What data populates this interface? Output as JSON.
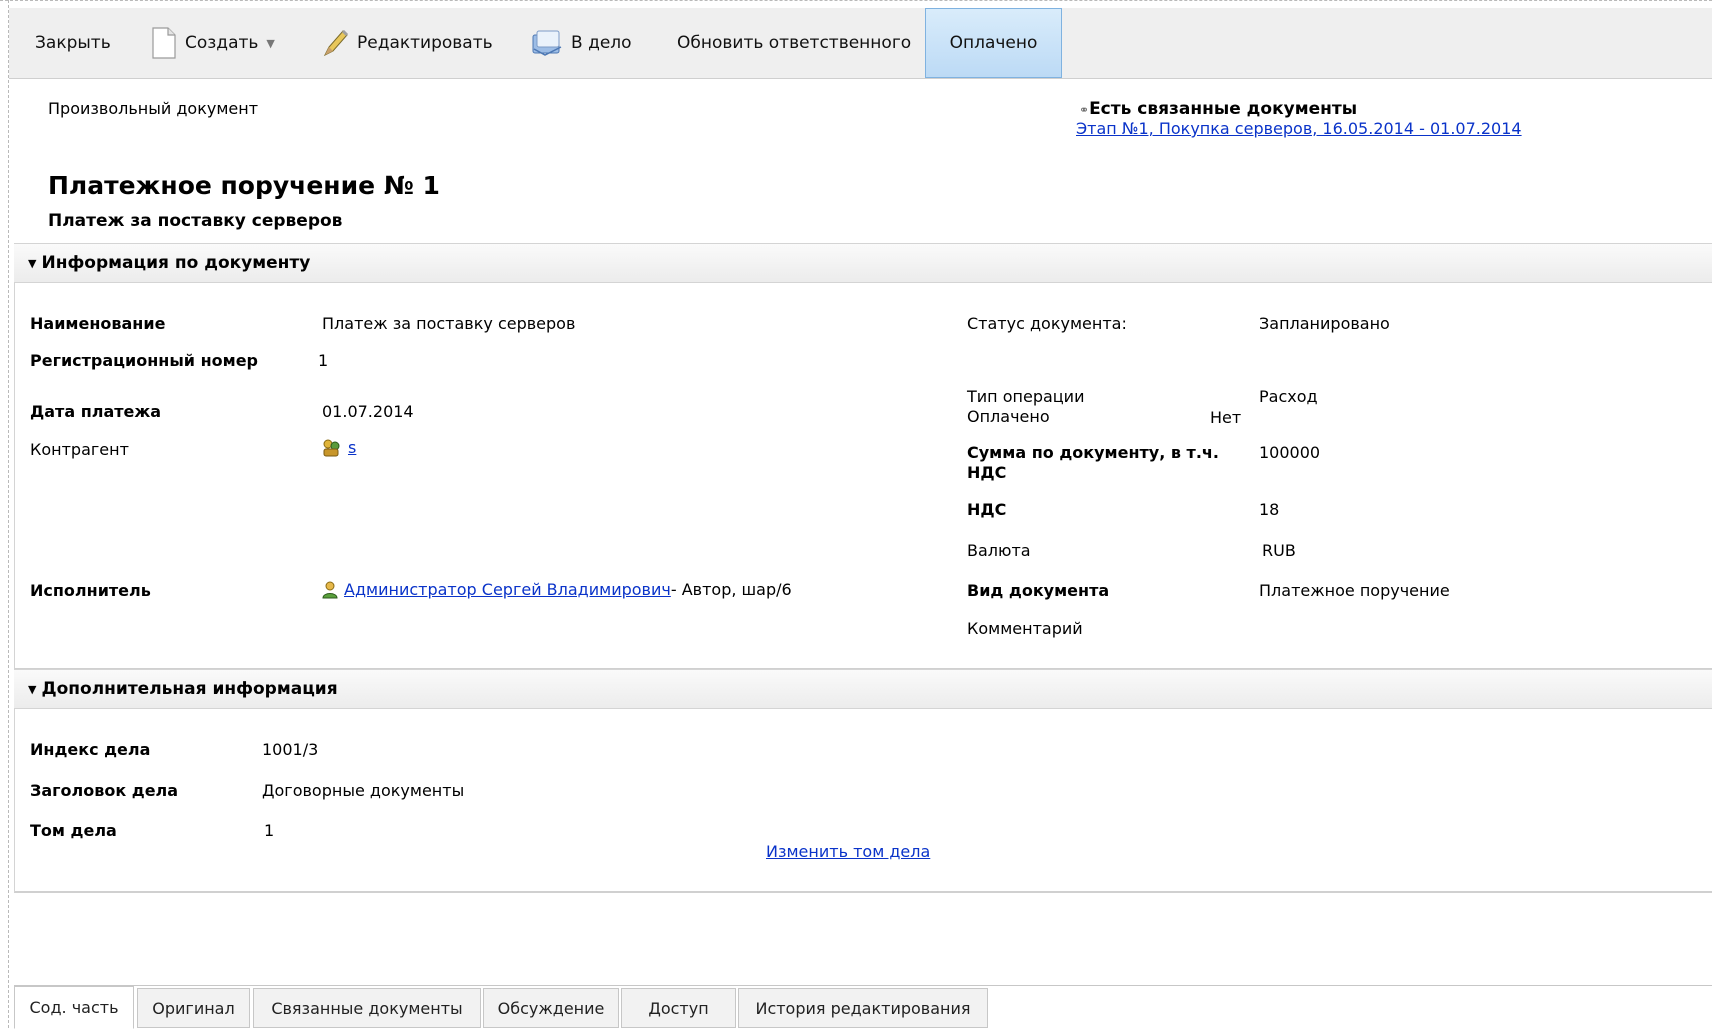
{
  "toolbar": {
    "close": "Закрыть",
    "create": "Создать",
    "edit": "Редактировать",
    "to_case": "В дело",
    "update_responsible": "Обновить ответственного",
    "paid": "Оплачено"
  },
  "doc": {
    "type_label": "Произвольный документ",
    "related_heading": "Есть связанные документы",
    "related_link": "Этап №1, Покупка серверов, 16.05.2014 - 01.07.2014",
    "title": "Платежное поручение № 1",
    "subtitle": "Платеж за поставку серверов"
  },
  "info_section": {
    "header": "Информация по документу",
    "name_label": "Наименование",
    "name_value": "Платеж за поставку серверов",
    "regnum_label": "Регистрационный номер",
    "regnum_value": "1",
    "paydate_label": "Дата платежа",
    "paydate_value": "01.07.2014",
    "counterparty_label": "Контрагент",
    "counterparty_value": "s",
    "executor_label": "Исполнитель",
    "executor_value": "Администратор Сергей Владимирович",
    "executor_suffix": " - Автор, шар/6",
    "status_label": "Статус документа:",
    "status_value": "Запланировано",
    "optype_label": "Тип операции",
    "optype_value": "Расход",
    "paid_label": "Оплачено",
    "paid_value": "Нет",
    "sum_label_1": "Сумма по документу, в т.ч.",
    "sum_label_2": "НДС",
    "sum_value": "100000",
    "vat_label": "НДС",
    "vat_value": "18",
    "currency_label": "Валюта",
    "currency_value": "RUB",
    "doctype_label": "Вид документа",
    "doctype_value": "Платежное поручение",
    "comment_label": "Комментарий"
  },
  "extra_section": {
    "header": "Дополнительная информация",
    "index_label": "Индекс дела",
    "index_value": "1001/3",
    "case_title_label": "Заголовок дела",
    "case_title_value": "Договорные документы",
    "volume_label": "Том дела",
    "volume_value": "1",
    "change_volume_link": "Изменить том дела"
  },
  "tabs": [
    {
      "label": "Сод. часть",
      "active": true
    },
    {
      "label": "Оригинал"
    },
    {
      "label": "Связанные документы"
    },
    {
      "label": "Обсуждение"
    },
    {
      "label": "Доступ"
    },
    {
      "label": "История редактирования"
    }
  ]
}
